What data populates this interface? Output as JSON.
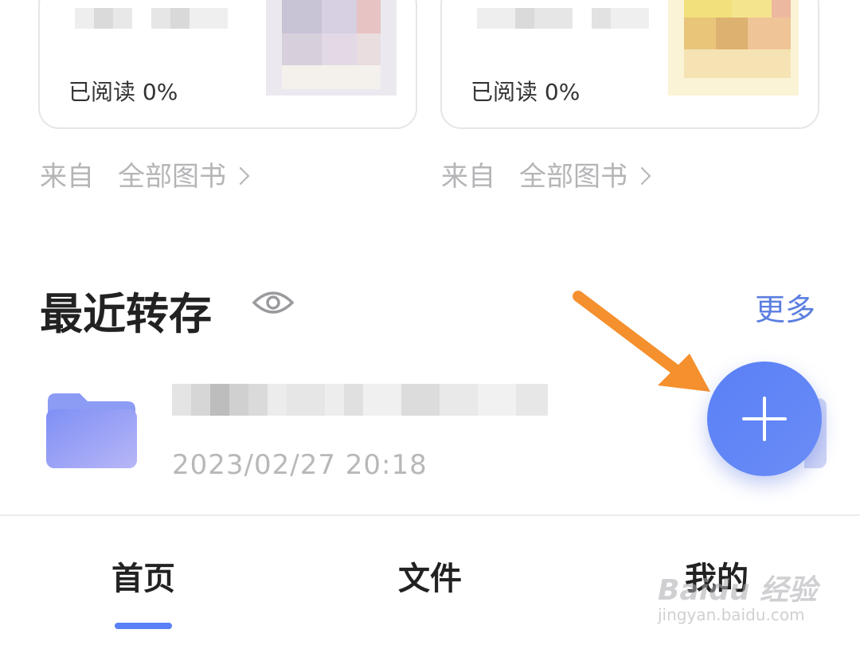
{
  "books": [
    {
      "progress": "已阅读 0%",
      "source_prefix": "来自",
      "source_name": "全部图书"
    },
    {
      "progress": "已阅读 0%",
      "source_prefix": "来自",
      "source_name": "全部图书"
    }
  ],
  "recent": {
    "title": "最近转存",
    "more": "更多",
    "items": [
      {
        "time": "2023/02/27 20:18"
      }
    ]
  },
  "tabs": [
    {
      "label": "首页",
      "active": true
    },
    {
      "label": "文件",
      "active": false
    },
    {
      "label": "我的",
      "active": false
    }
  ],
  "watermark": {
    "line1": "Baidu 经验",
    "line2": "jingyan.baidu.com"
  },
  "colors": {
    "accent": "#5a80f5",
    "arrow": "#f5902e"
  }
}
